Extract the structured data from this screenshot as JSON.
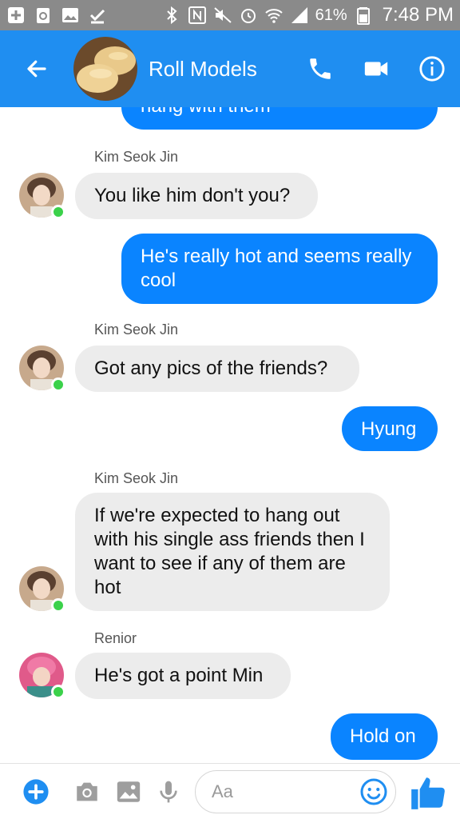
{
  "status_bar": {
    "battery_percent": "61%",
    "time": "7:48 PM"
  },
  "header": {
    "title": "Roll Models"
  },
  "messages": [
    {
      "kind": "out",
      "text": "hang with them"
    },
    {
      "kind": "sender",
      "text": "Kim Seok Jin"
    },
    {
      "kind": "in",
      "text": "You like him don't you?"
    },
    {
      "kind": "out",
      "text": "He's really hot and seems really cool"
    },
    {
      "kind": "sender",
      "text": "Kim Seok Jin"
    },
    {
      "kind": "in",
      "text": "Got any pics of the friends?"
    },
    {
      "kind": "out",
      "text": "Hyung"
    },
    {
      "kind": "sender",
      "text": "Kim Seok Jin"
    },
    {
      "kind": "in",
      "text": "If we're expected to hang out with his single ass friends then I want to see if any of them are hot"
    },
    {
      "kind": "sender",
      "text": "Renior"
    },
    {
      "kind": "in",
      "text": "He's got a point Min"
    },
    {
      "kind": "out",
      "text": "Hold on"
    }
  ],
  "composer": {
    "placeholder": "Aa"
  },
  "colors": {
    "header_blue": "#1f8ef1",
    "outgoing_bubble": "#0a84ff",
    "incoming_bubble": "#ececec",
    "online_dot": "#3bd14a"
  }
}
